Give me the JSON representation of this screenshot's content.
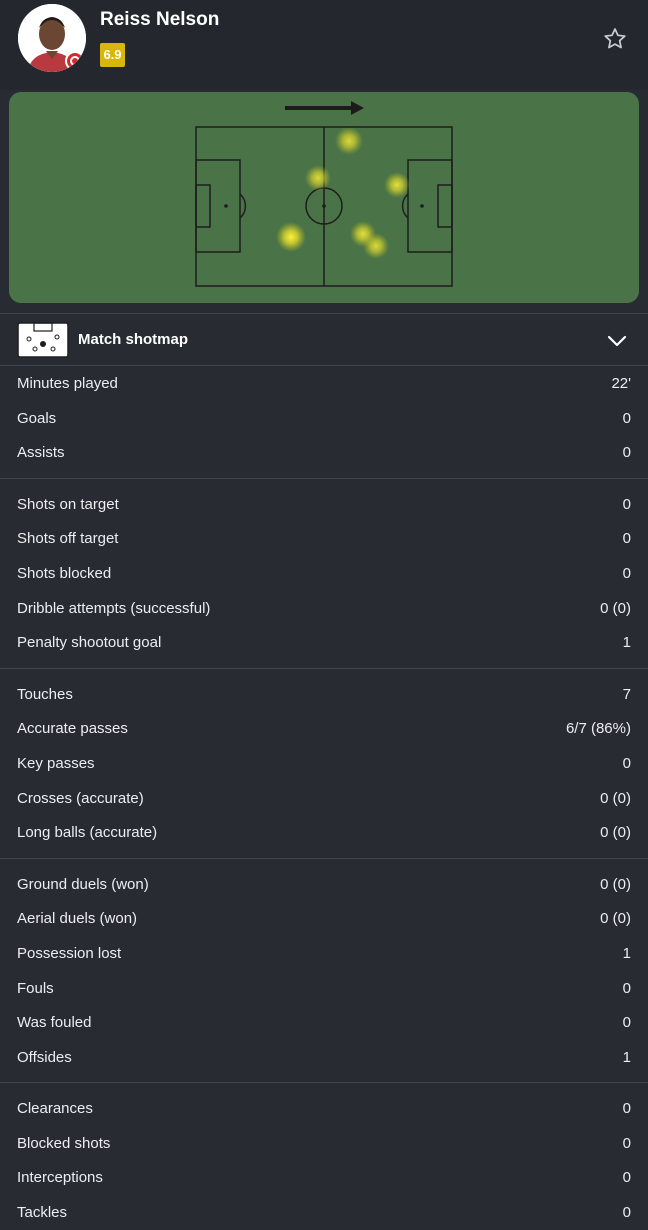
{
  "player": {
    "name": "Reiss Nelson",
    "rating": "6.9",
    "rating_color": "#d8b70a"
  },
  "shotmap": {
    "label": "Match shotmap"
  },
  "stat_groups": [
    {
      "rows": [
        {
          "label": "Minutes played",
          "value": "22'"
        },
        {
          "label": "Goals",
          "value": "0"
        },
        {
          "label": "Assists",
          "value": "0"
        }
      ]
    },
    {
      "rows": [
        {
          "label": "Shots on target",
          "value": "0"
        },
        {
          "label": "Shots off target",
          "value": "0"
        },
        {
          "label": "Shots blocked",
          "value": "0"
        },
        {
          "label": "Dribble attempts (successful)",
          "value": "0 (0)"
        },
        {
          "label": "Penalty shootout goal",
          "value": "1"
        }
      ]
    },
    {
      "rows": [
        {
          "label": "Touches",
          "value": "7"
        },
        {
          "label": "Accurate passes",
          "value": "6/7 (86%)"
        },
        {
          "label": "Key passes",
          "value": "0"
        },
        {
          "label": "Crosses (accurate)",
          "value": "0 (0)"
        },
        {
          "label": "Long balls (accurate)",
          "value": "0 (0)"
        }
      ]
    },
    {
      "rows": [
        {
          "label": "Ground duels (won)",
          "value": "0 (0)"
        },
        {
          "label": "Aerial duels (won)",
          "value": "0 (0)"
        },
        {
          "label": "Possession lost",
          "value": "1"
        },
        {
          "label": "Fouls",
          "value": "0"
        },
        {
          "label": "Was fouled",
          "value": "0"
        },
        {
          "label": "Offsides",
          "value": "1"
        }
      ]
    },
    {
      "rows": [
        {
          "label": "Clearances",
          "value": "0"
        },
        {
          "label": "Blocked shots",
          "value": "0"
        },
        {
          "label": "Interceptions",
          "value": "0"
        },
        {
          "label": "Tackles",
          "value": "0"
        }
      ]
    }
  ],
  "icons": {
    "favorite": "star-outline-icon",
    "expand": "chevron-down-icon",
    "shotmap": "pitch-icon"
  }
}
